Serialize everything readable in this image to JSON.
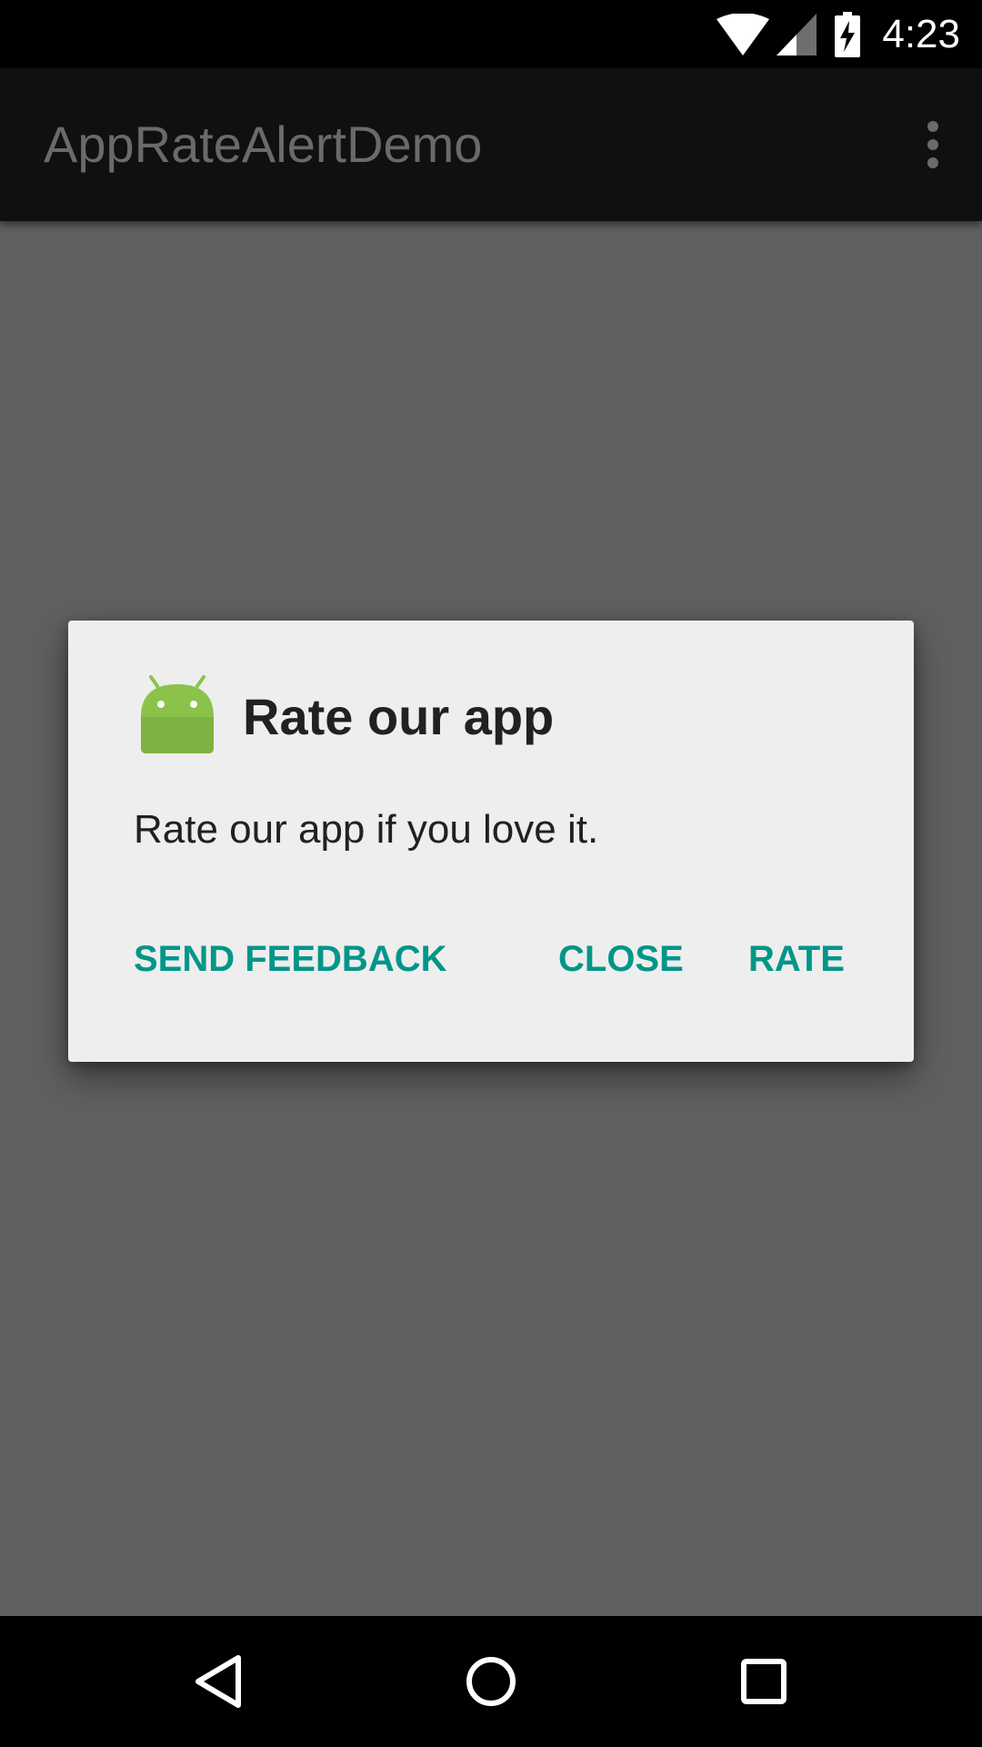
{
  "status_bar": {
    "time": "4:23",
    "icons": [
      "wifi-icon",
      "cell-signal-icon",
      "battery-charging-icon"
    ]
  },
  "app_bar": {
    "title": "AppRateAlertDemo",
    "overflow_icon": "more-vert-icon"
  },
  "dialog": {
    "icon": "android-icon",
    "title": "Rate our app",
    "message": "Rate our app if you love it.",
    "buttons": {
      "send_feedback": "SEND FEEDBACK",
      "close": "CLOSE",
      "rate": "RATE"
    }
  },
  "nav_bar": {
    "icons": [
      "back-icon",
      "home-icon",
      "recents-icon"
    ]
  },
  "colors": {
    "accent": "#009688",
    "dim_overlay": "#606060",
    "app_bar": "#101010",
    "dialog_background": "#eeeeee",
    "android_green": "#8bc34a"
  }
}
